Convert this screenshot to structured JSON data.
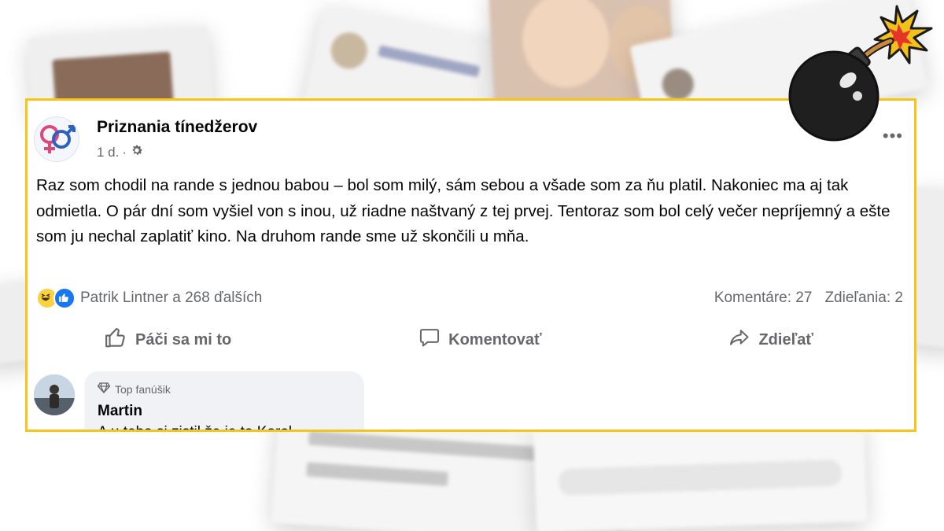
{
  "post": {
    "page_name": "Priznania tínedžerov",
    "time": "1 d.",
    "separator": "·",
    "more_label": "•••",
    "text": "Raz som chodil na rande s jednou babou – bol som milý, sám sebou a všade som za ňu platil. Nakoniec ma aj tak odmietla. O pár dní som vyšiel von s inou, už riadne naštvaný z tej prvej. Tentoraz som bol celý večer nepríjemný a ešte som ju nechal zaplatiť kino. Na druhom rande sme už skončili u mňa.",
    "reactions": {
      "summary": "Patrik Lintner a 268 ďalších",
      "types": [
        "haha",
        "like"
      ]
    },
    "comments_count": "Komentáre: 27",
    "shares_count": "Zdieľania: 2"
  },
  "actions": {
    "like_label": "Páči sa mi to",
    "comment_label": "Komentovať",
    "share_label": "Zdieľať"
  },
  "comment": {
    "badge": "Top fanúšik",
    "author": "Martin",
    "text": "A u teba si zistil že je to Karol"
  },
  "colors": {
    "highlight_border": "#f5c518",
    "text_primary": "#050505",
    "text_secondary": "#65676b",
    "like_blue": "#1877f2",
    "bubble_bg": "#f0f2f5"
  },
  "icons": {
    "gear": "gear-icon",
    "like": "thumbs-up-icon",
    "comment": "speech-bubble-icon",
    "share": "share-arrow-icon",
    "badge": "diamond-icon",
    "sticker": "bomb-icon"
  }
}
